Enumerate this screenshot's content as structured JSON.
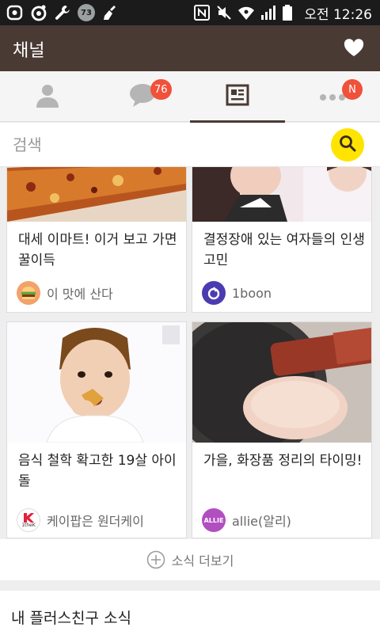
{
  "status_bar": {
    "left_icons": [
      "kakaotalk-icon",
      "kakaostory-icon",
      "wrench-icon",
      "notification-badge-icon",
      "broom-icon"
    ],
    "notification_count": "73",
    "right_icons": [
      "nfc-icon",
      "mute-icon",
      "wifi-icon",
      "signal-icon",
      "battery-icon"
    ],
    "time": "오전 12:26"
  },
  "header": {
    "title": "채널",
    "favorite_icon": "heart-icon"
  },
  "tabs": [
    {
      "name": "friends",
      "icon": "person-icon",
      "badge": ""
    },
    {
      "name": "chats",
      "icon": "chat-bubble-icon",
      "badge": "76"
    },
    {
      "name": "channel",
      "icon": "news-icon",
      "badge": "",
      "active": true
    },
    {
      "name": "more",
      "icon": "more-dots-icon",
      "badge": "N"
    }
  ],
  "search": {
    "placeholder": "검색",
    "button_icon": "search-icon"
  },
  "cards": [
    {
      "title": "대세 이마트! 이거 보고 가면 꿀이득",
      "source": "이 맛에 산다",
      "source_icon": "burger-icon"
    },
    {
      "title": "결정장애 있는 여자들의 인생 고민",
      "source": "1boon",
      "source_icon": "1boon-logo"
    },
    {
      "title": "음식 철학 확고한 19살 아이돌",
      "source": "케이팝은 원더케이",
      "source_icon": "1thek-logo",
      "source_logo_text": "1theK"
    },
    {
      "title": "가을, 화장품 정리의 타이밍!",
      "source": "allie(알리)",
      "source_icon": "allie-logo",
      "source_logo_text": "ALLIE"
    }
  ],
  "more": {
    "label": "소식 더보기",
    "icon": "plus-circle-icon"
  },
  "friends_news": {
    "title": "내 플러스친구 소식"
  },
  "colors": {
    "header": "#4a3a34",
    "badge": "#f0513a",
    "search_button": "#ffe400"
  }
}
